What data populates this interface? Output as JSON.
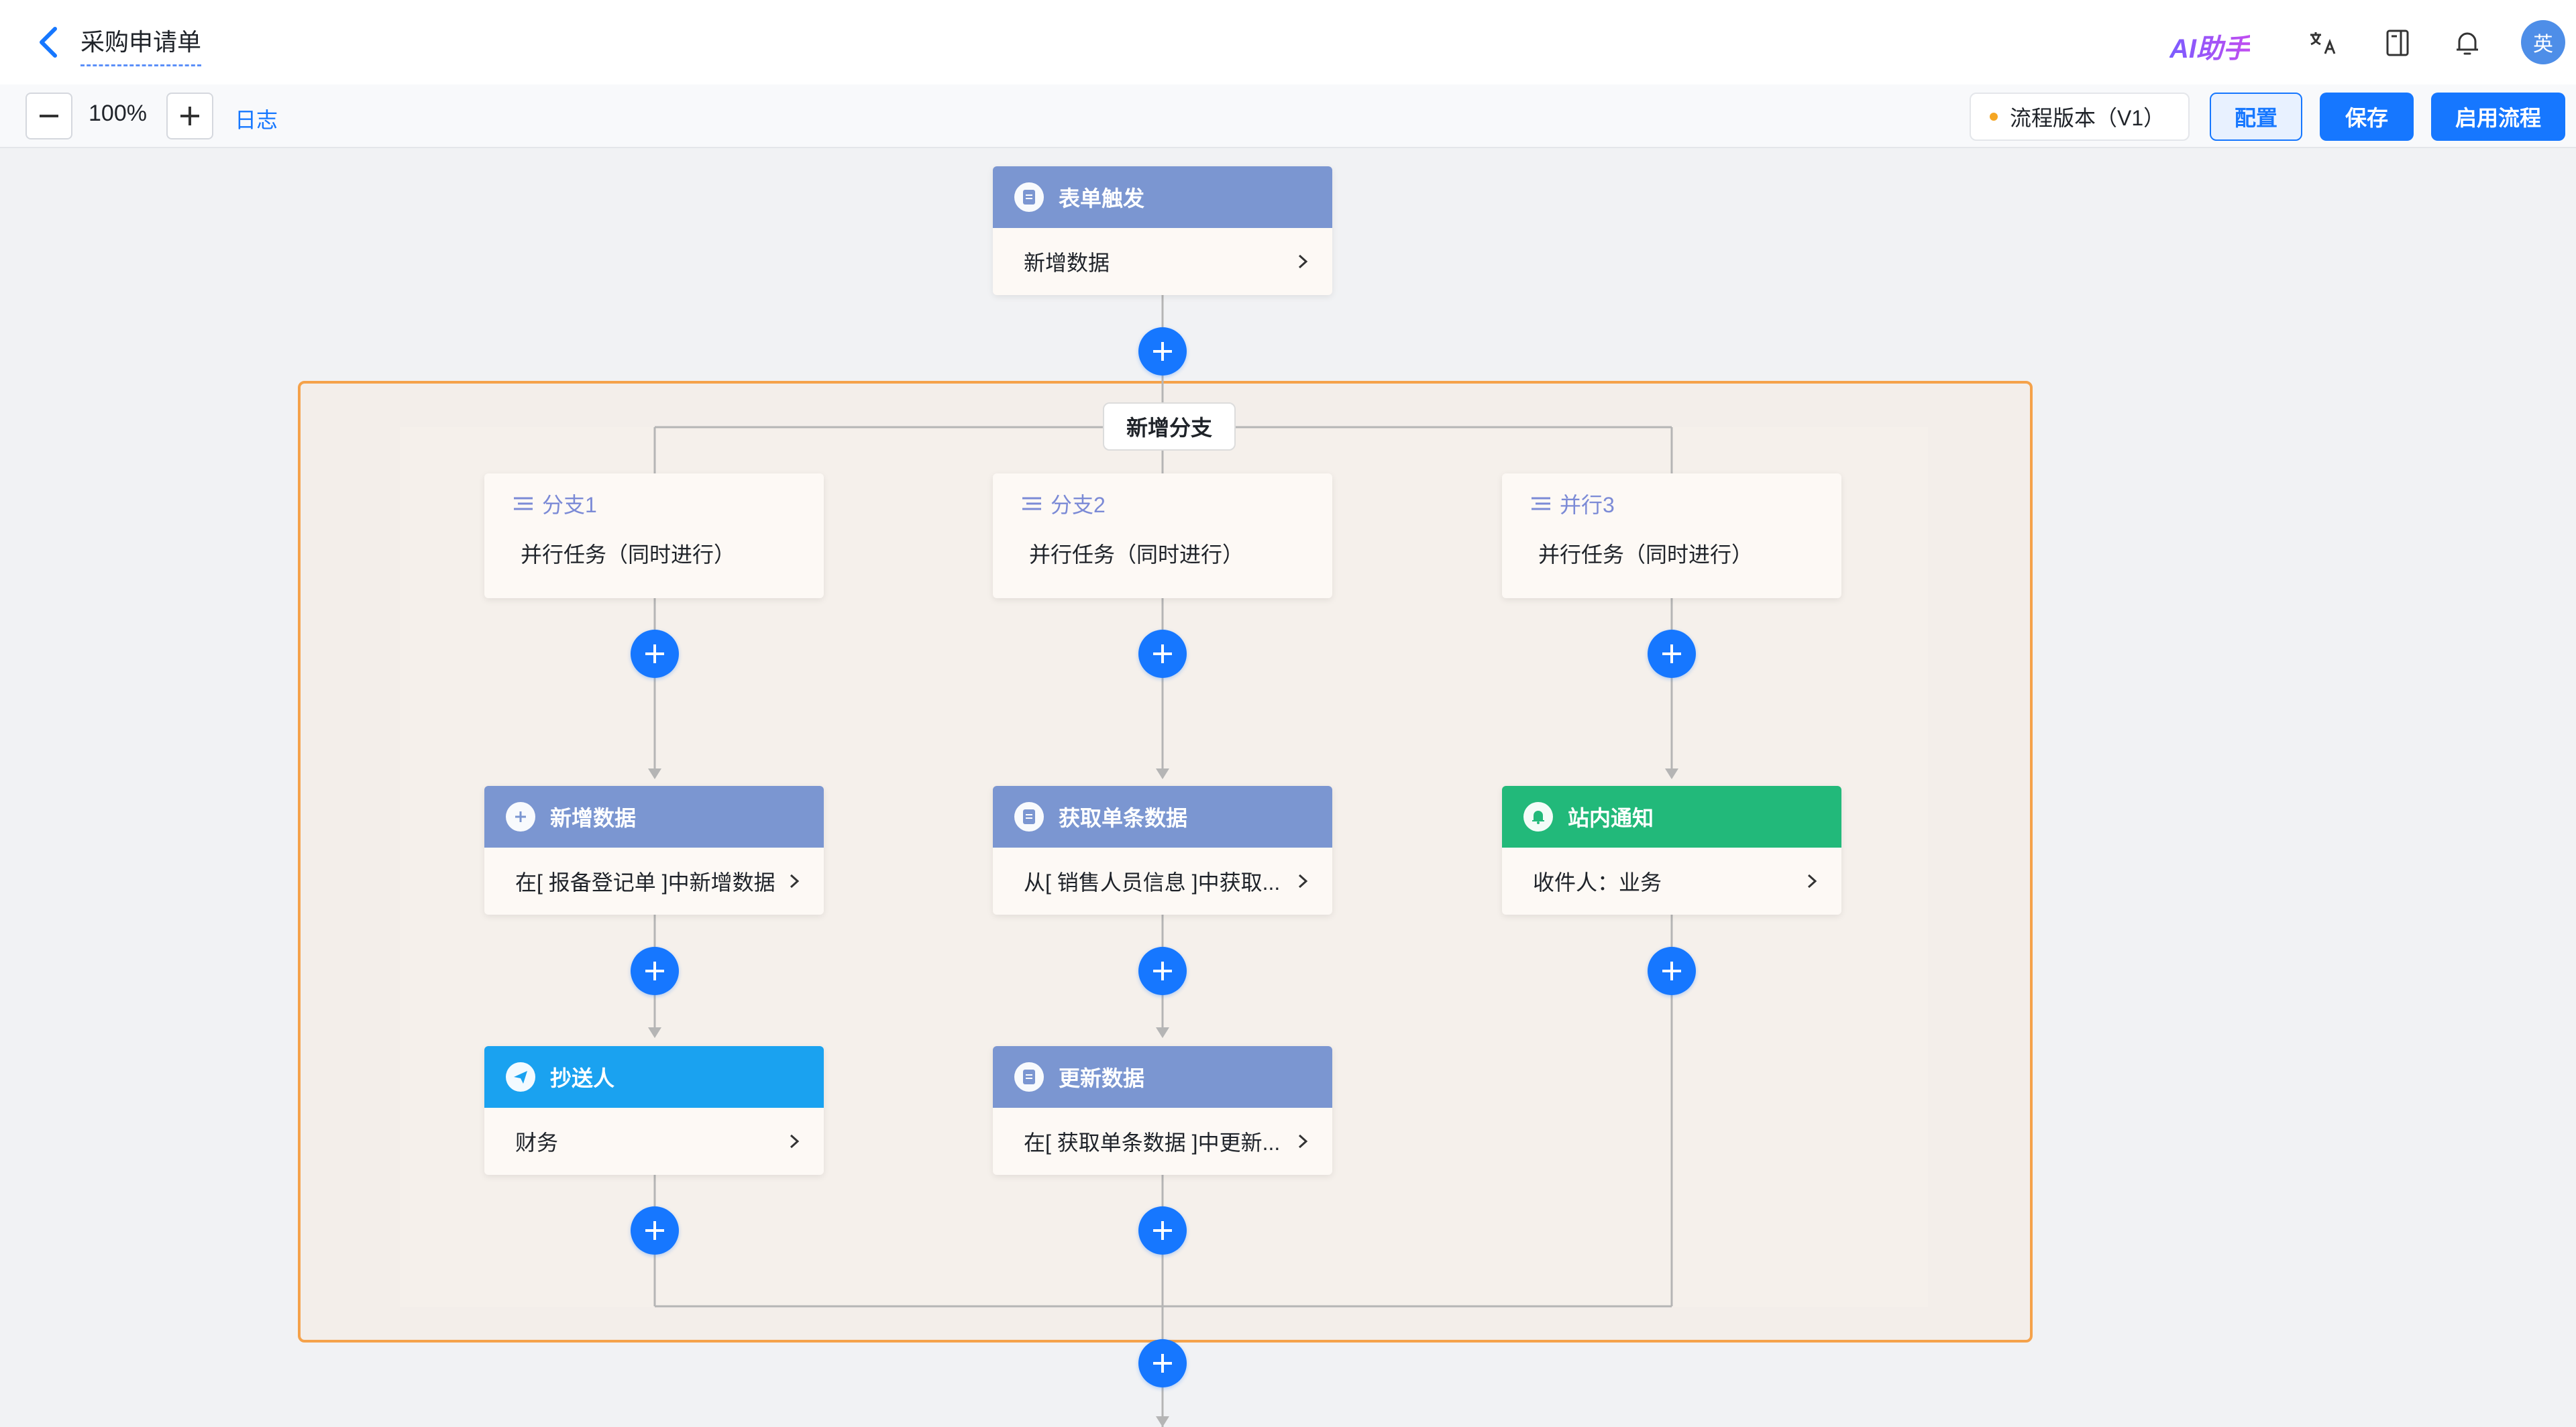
{
  "header": {
    "title": "采购申请单",
    "ai_label": "AI助手",
    "avatar_text": "英"
  },
  "toolbar": {
    "zoom": "100%",
    "log_label": "日志",
    "version_label": "流程版本（V1）",
    "config_label": "配置",
    "save_label": "保存",
    "enable_label": "启用流程"
  },
  "flow": {
    "trigger": {
      "title": "表单触发",
      "body": "新增数据"
    },
    "add_branch_label": "新增分支",
    "branches": [
      {
        "title": "分支1",
        "body": "并行任务（同时进行）"
      },
      {
        "title": "分支2",
        "body": "并行任务（同时进行）"
      },
      {
        "title": "并行3",
        "body": "并行任务（同时进行）"
      }
    ],
    "nodes": {
      "b1n1": {
        "title": "新增数据",
        "body": "在[ 报备登记单 ]中新增数据"
      },
      "b1n2": {
        "title": "抄送人",
        "body": "财务"
      },
      "b2n1": {
        "title": "获取单条数据",
        "body": "从[ 销售人员信息 ]中获取..."
      },
      "b2n2": {
        "title": "更新数据",
        "body": "在[ 获取单条数据 ]中更新..."
      },
      "b3n1": {
        "title": "站内通知",
        "body": "收件人：业务"
      }
    }
  },
  "colors": {
    "accent": "#1677ff",
    "node_default": "#7b96d1",
    "node_cc": "#1aa2f0",
    "node_notify": "#22b97a",
    "group_border": "#f5a24a"
  }
}
